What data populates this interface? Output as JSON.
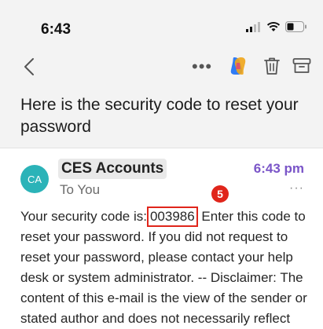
{
  "status_bar": {
    "time": "6:43"
  },
  "nav": {
    "more_label": "•••"
  },
  "email": {
    "subject": "Here is the security code to reset your password",
    "sender_initials": "CA",
    "sender_name": "CES Accounts",
    "recipient": "To You",
    "time": "6:43 pm",
    "more_label": "···",
    "body_prefix": "Your security code is:",
    "security_code": "003986",
    "body_rest": " Enter this code to reset your password. If you did not request to reset your password, please contact your help desk or system administrator. -- Disclaimer: The content of this e-mail is the view of the sender or stated author and does not necessarily reflect"
  },
  "annotation": {
    "marker_label": "5"
  },
  "colors": {
    "accent": "#7a55c8",
    "avatar": "#2bb3b8",
    "marker": "#e0251b"
  }
}
